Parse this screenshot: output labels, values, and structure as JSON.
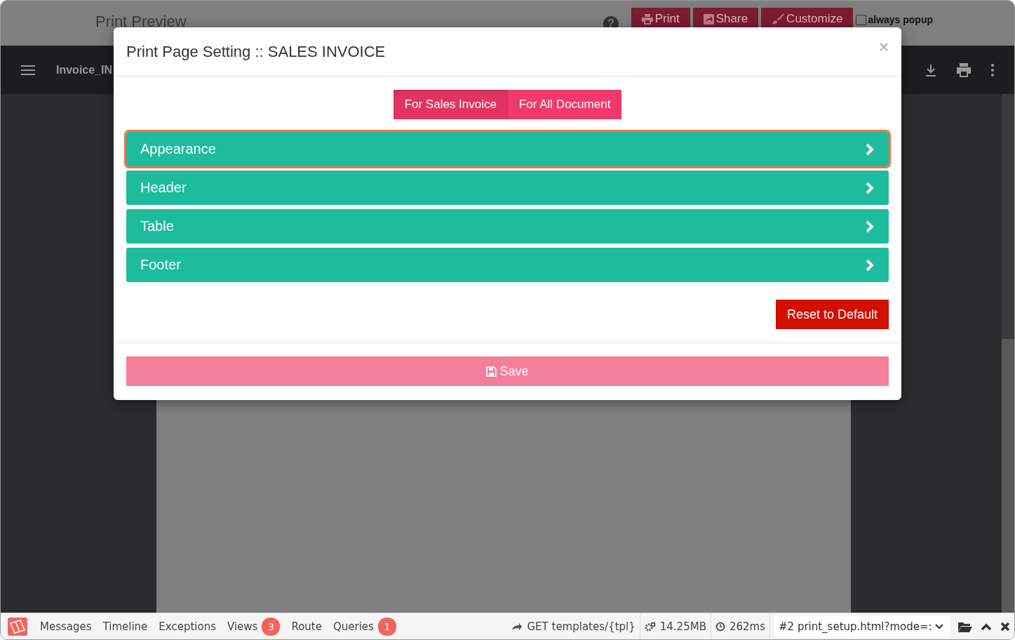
{
  "page": {
    "title": "Print Preview",
    "help": "?",
    "buttons": [
      {
        "kind": "print",
        "label": "Print"
      },
      {
        "kind": "share",
        "label": "Share"
      },
      {
        "kind": "customize",
        "label": "Customize"
      }
    ],
    "always_popup": {
      "label": "always popup",
      "checked": false
    }
  },
  "viewer": {
    "file_name": "Invoice_IN"
  },
  "modal": {
    "title": "Print Page Setting :: SALES INVOICE",
    "close": "×",
    "tabs": [
      {
        "label": "For Sales Invoice",
        "selected": true
      },
      {
        "label": "For All Document",
        "selected": false
      }
    ],
    "sections": [
      {
        "label": "Appearance",
        "focused": true
      },
      {
        "label": "Header",
        "focused": false
      },
      {
        "label": "Table",
        "focused": false
      },
      {
        "label": "Footer",
        "focused": false
      }
    ],
    "reset_button": "Reset to Default",
    "save_button": "Save"
  },
  "debugbar": {
    "tabs": [
      {
        "label": "Messages"
      },
      {
        "label": "Timeline"
      },
      {
        "label": "Exceptions"
      },
      {
        "label": "Views",
        "badge": "3"
      },
      {
        "label": "Route"
      },
      {
        "label": "Queries",
        "badge": "1"
      }
    ],
    "route": "GET templates/{tpl}",
    "memory": "14.25MB",
    "time": "262ms",
    "request": "#2 print_setup.html?mode=:"
  }
}
